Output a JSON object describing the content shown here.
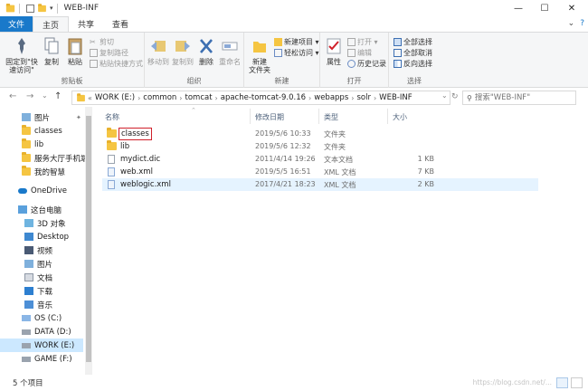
{
  "window": {
    "title": "WEB-INF",
    "controls": {
      "minimize": "—",
      "maximize": "☐",
      "close": "✕"
    }
  },
  "ribbon": {
    "tabs": [
      "文件",
      "主页",
      "共享",
      "查看"
    ],
    "active_tab": "主页",
    "clipboard": {
      "label": "剪贴板",
      "pin": "固定到\"快速访问\"",
      "copy": "复制",
      "paste": "粘贴",
      "cut": "剪切",
      "copy_path": "复制路径",
      "paste_shortcut": "粘贴快捷方式"
    },
    "organize": {
      "label": "组织",
      "move_to": "移动到",
      "copy_to": "复制到",
      "delete": "删除",
      "rename": "重命名"
    },
    "new": {
      "label": "新建",
      "new_folder": "新建\n文件夹",
      "new_item": "新建项目 ▾",
      "easy_access": "轻松访问 ▾"
    },
    "open": {
      "label": "打开",
      "properties": "属性",
      "open": "打开 ▾",
      "edit": "编辑",
      "history": "历史记录"
    },
    "select": {
      "label": "选择",
      "select_all": "全部选择",
      "select_none": "全部取消",
      "invert": "反向选择"
    }
  },
  "nav": {
    "back": "←",
    "forward": "→",
    "recent": "⌄",
    "up": "↑",
    "breadcrumb": [
      "WORK (E:)",
      "common",
      "tomcat",
      "apache-tomcat-9.0.16",
      "webapps",
      "solr",
      "WEB-INF"
    ],
    "breadcrumb_prefix": "«",
    "search_placeholder": "搜索\"WEB-INF\""
  },
  "sidebar": {
    "quick": [
      "图片",
      "classes",
      "lib",
      "服务大厅手机端",
      "我的智慧"
    ],
    "onedrive": "OneDrive",
    "pc": "这台电脑",
    "pc_items": [
      "3D 对象",
      "Desktop",
      "视频",
      "图片",
      "文档",
      "下载",
      "音乐",
      "OS (C:)",
      "DATA (D:)",
      "WORK (E:)",
      "GAME (F:)"
    ],
    "selected": "WORK (E:)",
    "trailing": "OS (C:)"
  },
  "columns": {
    "name": "名称",
    "date": "修改日期",
    "type": "类型",
    "size": "大小"
  },
  "files": [
    {
      "name": "classes",
      "date": "2019/5/6 10:33",
      "type": "文件夹",
      "size": "",
      "kind": "folder"
    },
    {
      "name": "lib",
      "date": "2019/5/6 12:32",
      "type": "文件夹",
      "size": "",
      "kind": "folder"
    },
    {
      "name": "mydict.dic",
      "date": "2011/4/14 19:26",
      "type": "文本文档",
      "size": "1 KB",
      "kind": "text"
    },
    {
      "name": "web.xml",
      "date": "2019/5/5 16:51",
      "type": "XML 文档",
      "size": "7 KB",
      "kind": "xml"
    },
    {
      "name": "weblogic.xml",
      "date": "2017/4/21 18:23",
      "type": "XML 文档",
      "size": "2 KB",
      "kind": "xml"
    }
  ],
  "status": {
    "count": "5 个项目",
    "watermark": "https://blog.csdn.net/..."
  },
  "colors": {
    "file_tab": "#1979ca",
    "selection": "#cce8ff",
    "highlight_box": "#d0202a",
    "folder": "#f5c542"
  }
}
